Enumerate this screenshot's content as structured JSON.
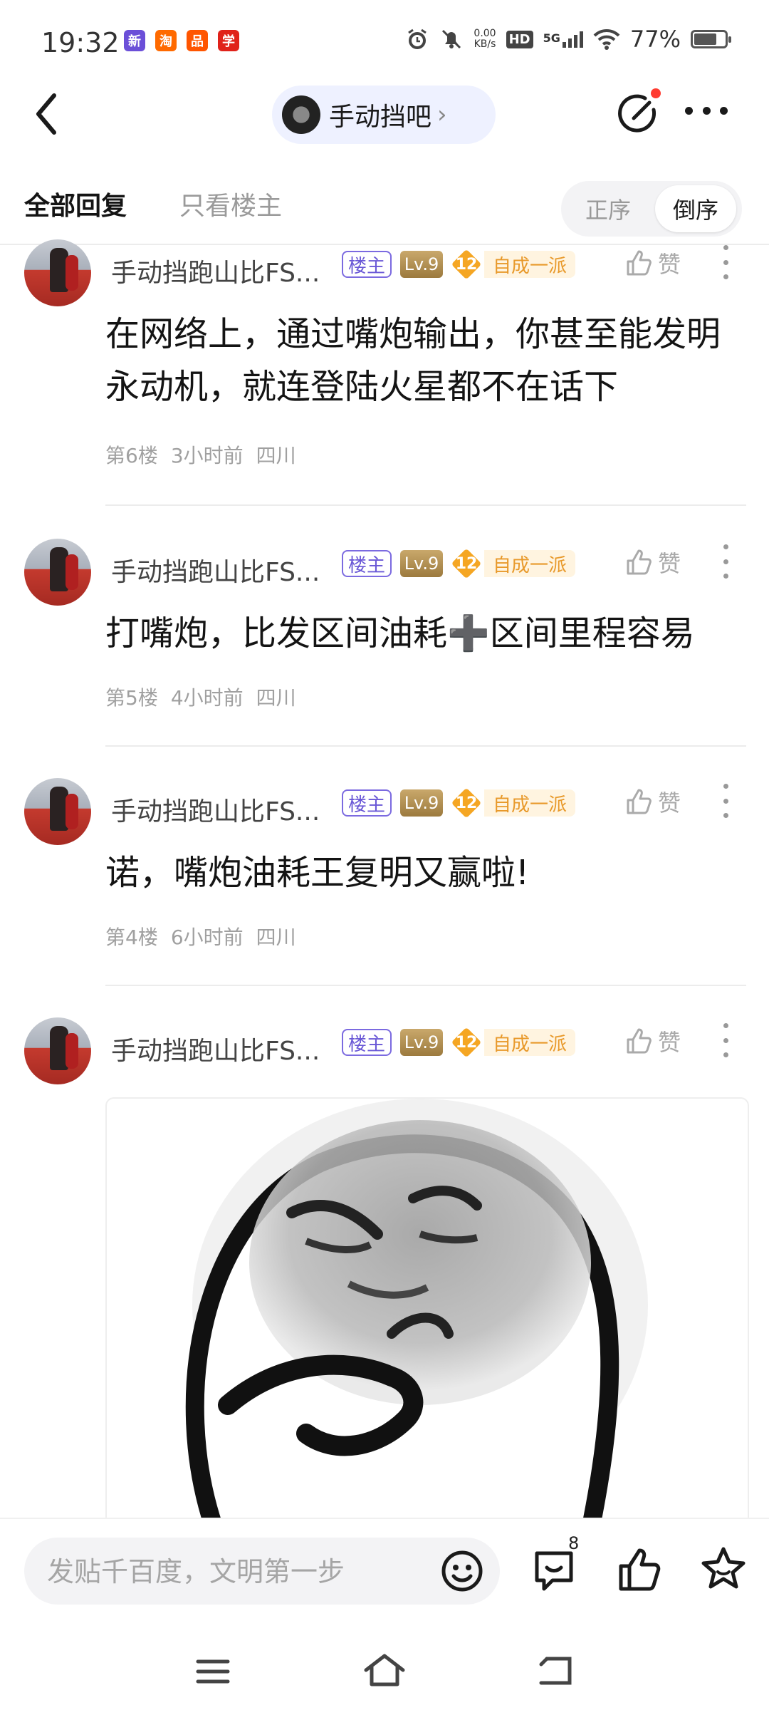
{
  "status_bar": {
    "time": "19:32",
    "net_speed_value": "0.00",
    "net_speed_unit": "KB/s",
    "hd_label": "HD",
    "network_label": "5G",
    "battery": "77%",
    "battery_level": 0.77,
    "app_badges": [
      {
        "icon": "app-badge-1",
        "glyph": "新",
        "color": "#6b4fd8"
      },
      {
        "icon": "taobao-icon",
        "glyph": "淘",
        "color": "#ff6a00"
      },
      {
        "icon": "app-badge-3",
        "glyph": "品",
        "color": "#ff5500"
      },
      {
        "icon": "app-badge-4",
        "glyph": "学",
        "color": "#e0221a"
      }
    ]
  },
  "nav": {
    "forum_name": "手动挡吧",
    "forum_chevron": "›"
  },
  "tabs": {
    "all_replies": "全部回复",
    "only_op": "只看楼主",
    "sort_asc": "正序",
    "sort_desc": "倒序"
  },
  "posts": [
    {
      "username": "手动挡跑山比FS...",
      "host_tag": "楼主",
      "level": "Lv.9",
      "title_level": "12",
      "title": "自成一派",
      "like_label": "赞",
      "content": "在网络上，通过嘴炮输出，你甚至能发明永动机，就连登陆火星都不在话下",
      "floor": "第6楼",
      "time": "3小时前",
      "location": "四川"
    },
    {
      "username": "手动挡跑山比FS...",
      "host_tag": "楼主",
      "level": "Lv.9",
      "title_level": "12",
      "title": "自成一派",
      "like_label": "赞",
      "content": "打嘴炮，比发区间油耗➕区间里程容易",
      "floor": "第5楼",
      "time": "4小时前",
      "location": "四川"
    },
    {
      "username": "手动挡跑山比FS...",
      "host_tag": "楼主",
      "level": "Lv.9",
      "title_level": "12",
      "title": "自成一派",
      "like_label": "赞",
      "content": "诺，嘴炮油耗王复明又赢啦!",
      "floor": "第4楼",
      "time": "6小时前",
      "location": "四川"
    },
    {
      "username": "手动挡跑山比FS...",
      "host_tag": "楼主",
      "level": "Lv.9",
      "title_level": "12",
      "title": "自成一派",
      "like_label": "赞",
      "image": "thinking-meme-face"
    }
  ],
  "bottom_bar": {
    "reply_placeholder": "发贴千百度，文明第一步",
    "comment_count": "8"
  }
}
